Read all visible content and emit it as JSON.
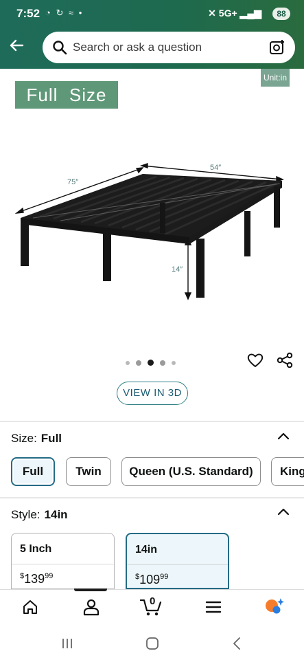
{
  "status_bar": {
    "time": "7:52",
    "network": "5G+",
    "battery": "88"
  },
  "search": {
    "placeholder": "Search or ask a question"
  },
  "product_image": {
    "unit_badge": "Unit:in",
    "size_banner": "Full  Size",
    "dimension_length": "75″",
    "dimension_width": "54″",
    "dimension_height": "14″"
  },
  "carousel": {
    "dots": 5,
    "active_index": 2
  },
  "view_3d_label": "VIEW IN 3D",
  "size_section": {
    "label": "Size:",
    "selected": "Full",
    "options": [
      "Full",
      "Twin",
      "Queen (U.S. Standard)",
      "King"
    ]
  },
  "style_section": {
    "label": "Style:",
    "selected": "14in",
    "options": [
      {
        "name": "5 Inch",
        "price_symbol": "$",
        "price_whole": "139",
        "price_fraction": "99"
      },
      {
        "name": "14in",
        "price_symbol": "$",
        "price_whole": "109",
        "price_fraction": "99"
      }
    ]
  },
  "bottom_nav": {
    "cart_count": "0",
    "items": [
      "home-icon",
      "account-icon",
      "cart-icon",
      "menu-icon",
      "rufus-icon"
    ]
  },
  "colors": {
    "header_start": "#1f6b5a",
    "header_end": "#2a6b3e",
    "selected_border": "#236b86",
    "selected_bg": "#edf6fa"
  }
}
